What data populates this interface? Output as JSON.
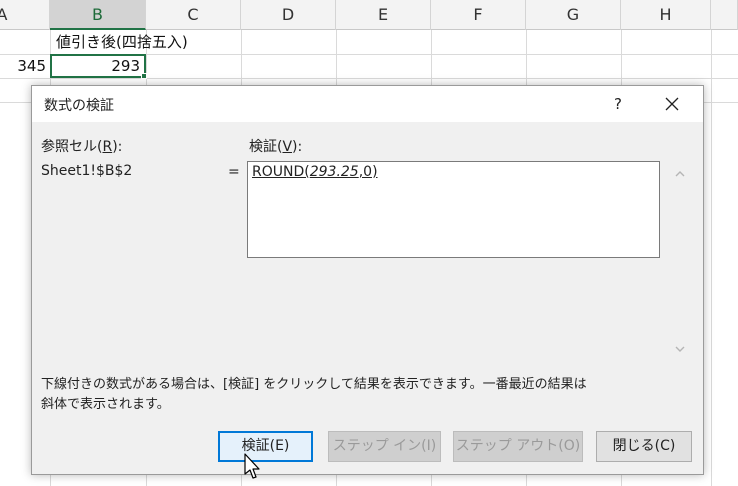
{
  "spreadsheet": {
    "columns": [
      "A",
      "B",
      "C",
      "D",
      "E",
      "F",
      "G",
      "H"
    ],
    "selected_column": "B",
    "header_text": "値引き後(四捨五入)",
    "cell_a2": "345",
    "cell_b2": "293"
  },
  "dialog": {
    "title": "数式の検証",
    "help_label": "?",
    "reference_label_pre": "参照セル(",
    "reference_label_key": "R",
    "reference_label_post": "):",
    "reference_value": "Sheet1!$B$2",
    "evaluation_label_pre": "検証(",
    "evaluation_label_key": "V",
    "evaluation_label_post": "):",
    "equals": "=",
    "formula_pre": "ROUND(",
    "formula_italic": "293.25",
    "formula_post": ",0)",
    "note_line1": "下線付きの数式がある場合は、[検証] をクリックして結果を表示できます。一番最近の結果は",
    "note_line2": "斜体で表示されます。",
    "buttons": {
      "evaluate": "検証(E)",
      "step_in": "ステップ イン(I)",
      "step_out": "ステップ アウト(O)",
      "close": "閉じる(C)"
    }
  },
  "colors": {
    "excel_green": "#217346",
    "focus_blue": "#0078d7"
  }
}
